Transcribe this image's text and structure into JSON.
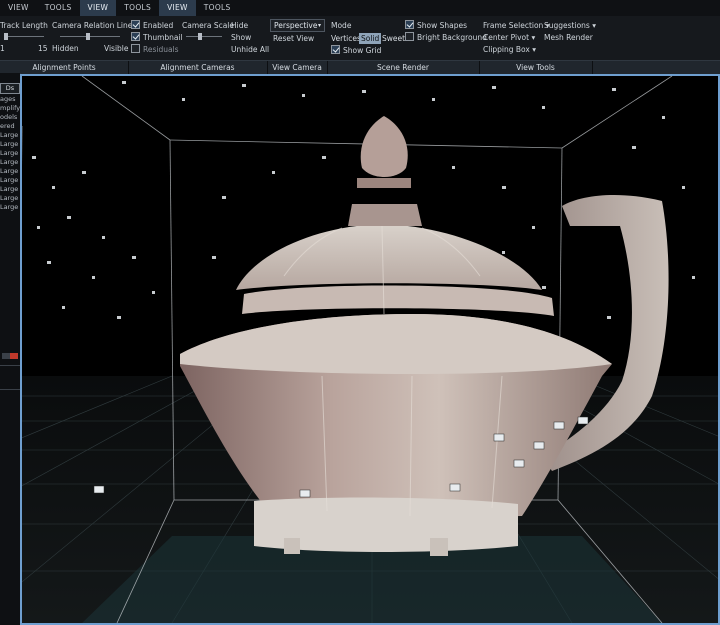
{
  "tabs": [
    {
      "label": "VIEW",
      "active": false
    },
    {
      "label": "TOOLS",
      "active": false
    },
    {
      "label": "VIEW",
      "active": true
    },
    {
      "label": "TOOLS",
      "active": false
    },
    {
      "label": "VIEW",
      "active": true
    },
    {
      "label": "TOOLS",
      "active": false
    }
  ],
  "alignment_points": {
    "track_length_label": "Track Length",
    "track_min": "1",
    "track_max": "15",
    "relation_lines_label": "Camera Relation Lines",
    "hidden_label": "Hidden",
    "visible_label": "Visible",
    "group_label": "Alignment Points"
  },
  "alignment_cameras": {
    "enabled_label": "Enabled",
    "enabled": true,
    "thumbnail_label": "Thumbnail",
    "thumbnail": true,
    "residuals_label": "Residuals",
    "residuals": false,
    "camera_scale_label": "Camera Scale",
    "hide_label": "Hide",
    "show_label": "Show",
    "unhide_all_label": "Unhide All",
    "group_label": "Alignment Cameras"
  },
  "view_camera": {
    "projection_value": "Perspective",
    "reset_label": "Reset View",
    "group_label": "View Camera"
  },
  "scene_render": {
    "mode_label": "Mode",
    "modes": [
      "Vertices",
      "Solid",
      "Sweet"
    ],
    "active_mode": "Solid",
    "show_grid_label": "Show Grid",
    "show_grid": true,
    "show_shapes_label": "Show Shapes",
    "show_shapes": true,
    "bright_bg_label": "Bright Background",
    "bright_bg": false,
    "group_label": "Scene Render"
  },
  "view_tools": {
    "frame_selection_label": "Frame Selection",
    "suggestions_label": "Suggestions",
    "center_pivot_label": "Center Pivot",
    "mesh_render_label": "Mesh Render",
    "clipping_box_label": "Clipping Box",
    "group_label": "View Tools"
  },
  "sidebar": {
    "tab_label": "Ds",
    "items": [
      "ages",
      "mplify",
      "odels",
      "ered",
      "Large",
      "Large",
      "Large",
      "Large",
      "Large",
      "Large",
      "Large",
      "Large",
      "Large"
    ]
  },
  "colors": {
    "accent": "#6f9fd0",
    "active_seg": "#8ea3b8",
    "ribbon": "#16191d"
  }
}
